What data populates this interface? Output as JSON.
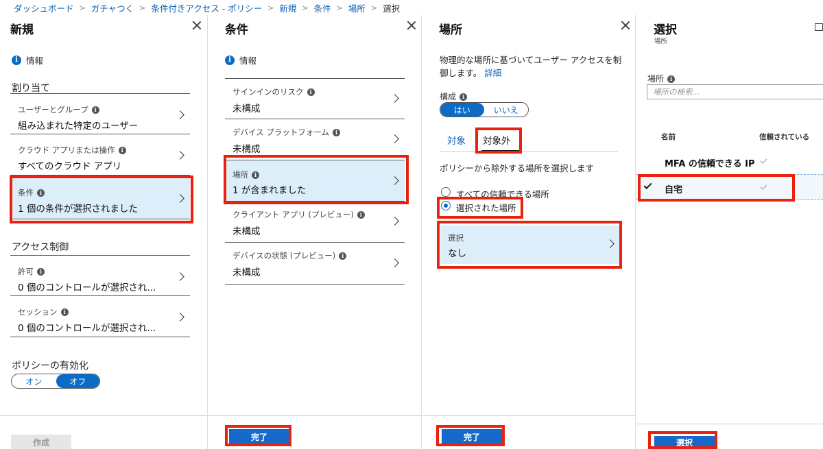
{
  "breadcrumb": {
    "items": [
      "ダッシュボード",
      "ガチャつく",
      "条件付きアクセス - ポリシー",
      "新規",
      "条件",
      "場所"
    ],
    "current": "選択"
  },
  "blade_new": {
    "title": "新規",
    "info": "情報",
    "assign_head": "割り当て",
    "items": [
      {
        "label": "ユーザーとグループ",
        "value": "組み込まれた特定のユーザー"
      },
      {
        "label": "クラウド アプリまたは操作",
        "value": "すべてのクラウド アプリ"
      },
      {
        "label": "条件",
        "value": "1 個の条件が選択されました"
      }
    ],
    "access_head": "アクセス制御",
    "access_items": [
      {
        "label": "許可",
        "value": "0 個のコントロールが選択され..."
      },
      {
        "label": "セッション",
        "value": "0 個のコントロールが選択され..."
      }
    ],
    "enable_head": "ポリシーの有効化",
    "toggle_on": "オン",
    "toggle_off": "オフ",
    "create_button": "作成"
  },
  "blade_conditions": {
    "title": "条件",
    "info": "情報",
    "items": [
      {
        "label": "サインインのリスク",
        "value": "未構成"
      },
      {
        "label": "デバイス プラットフォーム",
        "value": "未構成"
      },
      {
        "label": "場所",
        "value": "1 が含まれました"
      },
      {
        "label": "クライアント アプリ (プレビュー)",
        "value": "未構成"
      },
      {
        "label": "デバイスの状態 (プレビュー)",
        "value": "未構成"
      }
    ],
    "done_button": "完了"
  },
  "blade_locations": {
    "title": "場所",
    "description": "物理的な場所に基づいてユーザー アクセスを制御します。",
    "details_link": "詳細",
    "config_label": "構成",
    "toggle_yes": "はい",
    "toggle_no": "いいえ",
    "tab_include": "対象",
    "tab_exclude": "対象外",
    "exclude_prompt": "ポリシーから除外する場所を選択します",
    "radio_all": "すべての信頼できる場所",
    "radio_selected": "選択された場所",
    "select_label": "選択",
    "select_value": "なし",
    "done_button": "完了"
  },
  "blade_select": {
    "title": "選択",
    "subtitle": "場所",
    "search_label": "場所",
    "search_placeholder": "場所の検索...",
    "col_name": "名前",
    "col_trusted": "信頼されている",
    "rows": [
      {
        "name": "MFA の信頼できる IP",
        "trusted": true,
        "checked": false
      },
      {
        "name": "自宅",
        "trusted": true,
        "checked": true
      }
    ],
    "select_button": "選択"
  },
  "colors": {
    "accent": "#0b6cc6",
    "highlight": "#e8220f",
    "selected_bg": "#ddeefb"
  }
}
